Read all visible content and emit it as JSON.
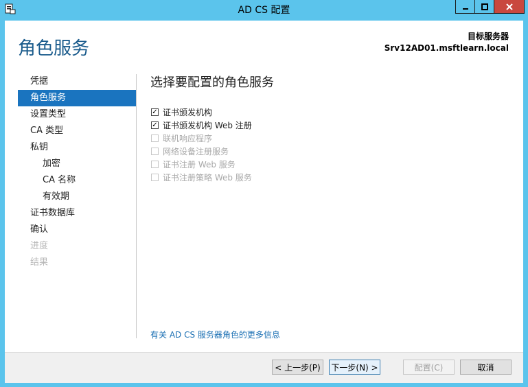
{
  "window": {
    "title": "AD CS 配置"
  },
  "header": {
    "title": "角色服务",
    "destination_label": "目标服务器",
    "destination_server": "Srv12AD01.msftlearn.local"
  },
  "nav": {
    "items": [
      {
        "label": "凭据",
        "level": 0,
        "state": "normal"
      },
      {
        "label": "角色服务",
        "level": 0,
        "state": "active"
      },
      {
        "label": "设置类型",
        "level": 0,
        "state": "normal"
      },
      {
        "label": "CA 类型",
        "level": 0,
        "state": "normal"
      },
      {
        "label": "私钥",
        "level": 0,
        "state": "normal"
      },
      {
        "label": "加密",
        "level": 1,
        "state": "normal"
      },
      {
        "label": "CA 名称",
        "level": 1,
        "state": "normal"
      },
      {
        "label": "有效期",
        "level": 1,
        "state": "normal"
      },
      {
        "label": "证书数据库",
        "level": 0,
        "state": "normal"
      },
      {
        "label": "确认",
        "level": 0,
        "state": "normal"
      },
      {
        "label": "进度",
        "level": 0,
        "state": "disabled"
      },
      {
        "label": "结果",
        "level": 0,
        "state": "disabled"
      }
    ]
  },
  "main": {
    "title": "选择要配置的角色服务",
    "roles": [
      {
        "label": "证书颁发机构",
        "checked": true,
        "enabled": true
      },
      {
        "label": "证书颁发机构 Web 注册",
        "checked": true,
        "enabled": true
      },
      {
        "label": "联机响应程序",
        "checked": false,
        "enabled": false
      },
      {
        "label": "网络设备注册服务",
        "checked": false,
        "enabled": false
      },
      {
        "label": "证书注册 Web 服务",
        "checked": false,
        "enabled": false
      },
      {
        "label": "证书注册策略 Web 服务",
        "checked": false,
        "enabled": false
      }
    ],
    "more_info_link": "有关 AD CS 服务器角色的更多信息"
  },
  "footer": {
    "back_label": "< 上一步(P)",
    "next_label": "下一步(N) >",
    "configure_label": "配置(C)",
    "cancel_label": "取消"
  },
  "colors": {
    "titlebar": "#5bc4ec",
    "accent": "#1a74bf",
    "header_text": "#1a5b8c",
    "close_button": "#c9483e"
  }
}
